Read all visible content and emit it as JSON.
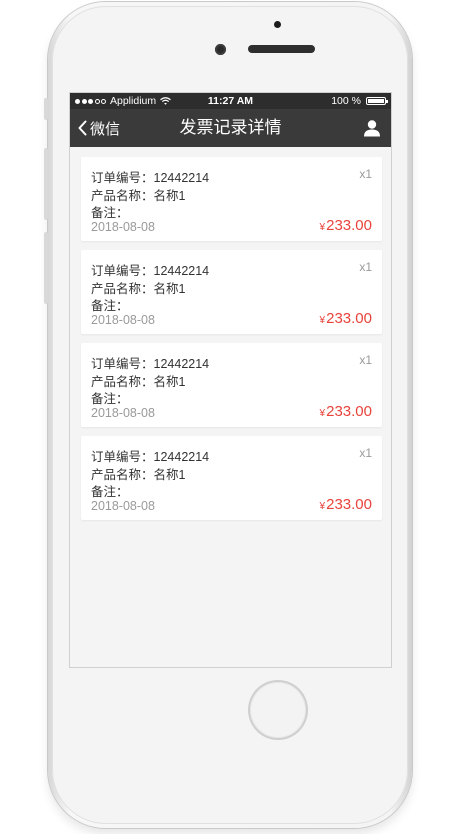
{
  "status_bar": {
    "carrier": "Applidium",
    "time": "11:27 AM",
    "battery": "100 %",
    "battery_level": 1.0,
    "signal_dots": [
      true,
      true,
      true,
      false,
      false
    ]
  },
  "nav": {
    "back_label": "微信",
    "title": "发票记录详情",
    "user_icon": "user-icon"
  },
  "records": [
    {
      "order_label": "订单编号：",
      "order_no": "12442214",
      "product_label": "产品名称：",
      "product_name": "名称1",
      "note_label": "备注：",
      "date": "2018-08-08",
      "qty": "x1",
      "currency": "¥",
      "price": "233.00"
    },
    {
      "order_label": "订单编号：",
      "order_no": "12442214",
      "product_label": "产品名称：",
      "product_name": "名称1",
      "note_label": "备注：",
      "date": "2018-08-08",
      "qty": "x1",
      "currency": "¥",
      "price": "233.00"
    },
    {
      "order_label": "订单编号：",
      "order_no": "12442214",
      "product_label": "产品名称：",
      "product_name": "名称1",
      "note_label": "备注：",
      "date": "2018-08-08",
      "qty": "x1",
      "currency": "¥",
      "price": "233.00"
    },
    {
      "order_label": "订单编号：",
      "order_no": "12442214",
      "product_label": "产品名称：",
      "product_name": "名称1",
      "note_label": "备注：",
      "date": "2018-08-08",
      "qty": "x1",
      "currency": "¥",
      "price": "233.00"
    }
  ],
  "colors": {
    "navbar": "#3a3a3a",
    "statusbar": "#2d2d2d",
    "price": "#e8433b",
    "background": "#f4f4f4"
  }
}
